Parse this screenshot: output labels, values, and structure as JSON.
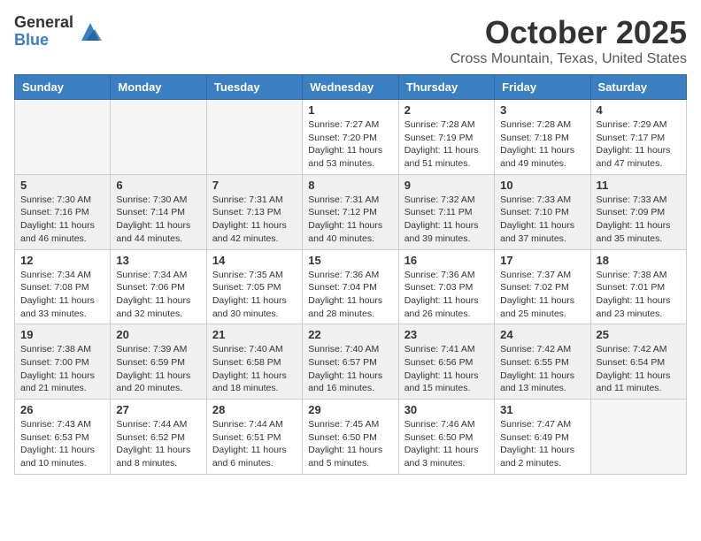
{
  "header": {
    "logo_general": "General",
    "logo_blue": "Blue",
    "month": "October 2025",
    "location": "Cross Mountain, Texas, United States"
  },
  "weekdays": [
    "Sunday",
    "Monday",
    "Tuesday",
    "Wednesday",
    "Thursday",
    "Friday",
    "Saturday"
  ],
  "weeks": [
    [
      {
        "day": "",
        "info": ""
      },
      {
        "day": "",
        "info": ""
      },
      {
        "day": "",
        "info": ""
      },
      {
        "day": "1",
        "info": "Sunrise: 7:27 AM\nSunset: 7:20 PM\nDaylight: 11 hours and 53 minutes."
      },
      {
        "day": "2",
        "info": "Sunrise: 7:28 AM\nSunset: 7:19 PM\nDaylight: 11 hours and 51 minutes."
      },
      {
        "day": "3",
        "info": "Sunrise: 7:28 AM\nSunset: 7:18 PM\nDaylight: 11 hours and 49 minutes."
      },
      {
        "day": "4",
        "info": "Sunrise: 7:29 AM\nSunset: 7:17 PM\nDaylight: 11 hours and 47 minutes."
      }
    ],
    [
      {
        "day": "5",
        "info": "Sunrise: 7:30 AM\nSunset: 7:16 PM\nDaylight: 11 hours and 46 minutes."
      },
      {
        "day": "6",
        "info": "Sunrise: 7:30 AM\nSunset: 7:14 PM\nDaylight: 11 hours and 44 minutes."
      },
      {
        "day": "7",
        "info": "Sunrise: 7:31 AM\nSunset: 7:13 PM\nDaylight: 11 hours and 42 minutes."
      },
      {
        "day": "8",
        "info": "Sunrise: 7:31 AM\nSunset: 7:12 PM\nDaylight: 11 hours and 40 minutes."
      },
      {
        "day": "9",
        "info": "Sunrise: 7:32 AM\nSunset: 7:11 PM\nDaylight: 11 hours and 39 minutes."
      },
      {
        "day": "10",
        "info": "Sunrise: 7:33 AM\nSunset: 7:10 PM\nDaylight: 11 hours and 37 minutes."
      },
      {
        "day": "11",
        "info": "Sunrise: 7:33 AM\nSunset: 7:09 PM\nDaylight: 11 hours and 35 minutes."
      }
    ],
    [
      {
        "day": "12",
        "info": "Sunrise: 7:34 AM\nSunset: 7:08 PM\nDaylight: 11 hours and 33 minutes."
      },
      {
        "day": "13",
        "info": "Sunrise: 7:34 AM\nSunset: 7:06 PM\nDaylight: 11 hours and 32 minutes."
      },
      {
        "day": "14",
        "info": "Sunrise: 7:35 AM\nSunset: 7:05 PM\nDaylight: 11 hours and 30 minutes."
      },
      {
        "day": "15",
        "info": "Sunrise: 7:36 AM\nSunset: 7:04 PM\nDaylight: 11 hours and 28 minutes."
      },
      {
        "day": "16",
        "info": "Sunrise: 7:36 AM\nSunset: 7:03 PM\nDaylight: 11 hours and 26 minutes."
      },
      {
        "day": "17",
        "info": "Sunrise: 7:37 AM\nSunset: 7:02 PM\nDaylight: 11 hours and 25 minutes."
      },
      {
        "day": "18",
        "info": "Sunrise: 7:38 AM\nSunset: 7:01 PM\nDaylight: 11 hours and 23 minutes."
      }
    ],
    [
      {
        "day": "19",
        "info": "Sunrise: 7:38 AM\nSunset: 7:00 PM\nDaylight: 11 hours and 21 minutes."
      },
      {
        "day": "20",
        "info": "Sunrise: 7:39 AM\nSunset: 6:59 PM\nDaylight: 11 hours and 20 minutes."
      },
      {
        "day": "21",
        "info": "Sunrise: 7:40 AM\nSunset: 6:58 PM\nDaylight: 11 hours and 18 minutes."
      },
      {
        "day": "22",
        "info": "Sunrise: 7:40 AM\nSunset: 6:57 PM\nDaylight: 11 hours and 16 minutes."
      },
      {
        "day": "23",
        "info": "Sunrise: 7:41 AM\nSunset: 6:56 PM\nDaylight: 11 hours and 15 minutes."
      },
      {
        "day": "24",
        "info": "Sunrise: 7:42 AM\nSunset: 6:55 PM\nDaylight: 11 hours and 13 minutes."
      },
      {
        "day": "25",
        "info": "Sunrise: 7:42 AM\nSunset: 6:54 PM\nDaylight: 11 hours and 11 minutes."
      }
    ],
    [
      {
        "day": "26",
        "info": "Sunrise: 7:43 AM\nSunset: 6:53 PM\nDaylight: 11 hours and 10 minutes."
      },
      {
        "day": "27",
        "info": "Sunrise: 7:44 AM\nSunset: 6:52 PM\nDaylight: 11 hours and 8 minutes."
      },
      {
        "day": "28",
        "info": "Sunrise: 7:44 AM\nSunset: 6:51 PM\nDaylight: 11 hours and 6 minutes."
      },
      {
        "day": "29",
        "info": "Sunrise: 7:45 AM\nSunset: 6:50 PM\nDaylight: 11 hours and 5 minutes."
      },
      {
        "day": "30",
        "info": "Sunrise: 7:46 AM\nSunset: 6:50 PM\nDaylight: 11 hours and 3 minutes."
      },
      {
        "day": "31",
        "info": "Sunrise: 7:47 AM\nSunset: 6:49 PM\nDaylight: 11 hours and 2 minutes."
      },
      {
        "day": "",
        "info": ""
      }
    ]
  ]
}
